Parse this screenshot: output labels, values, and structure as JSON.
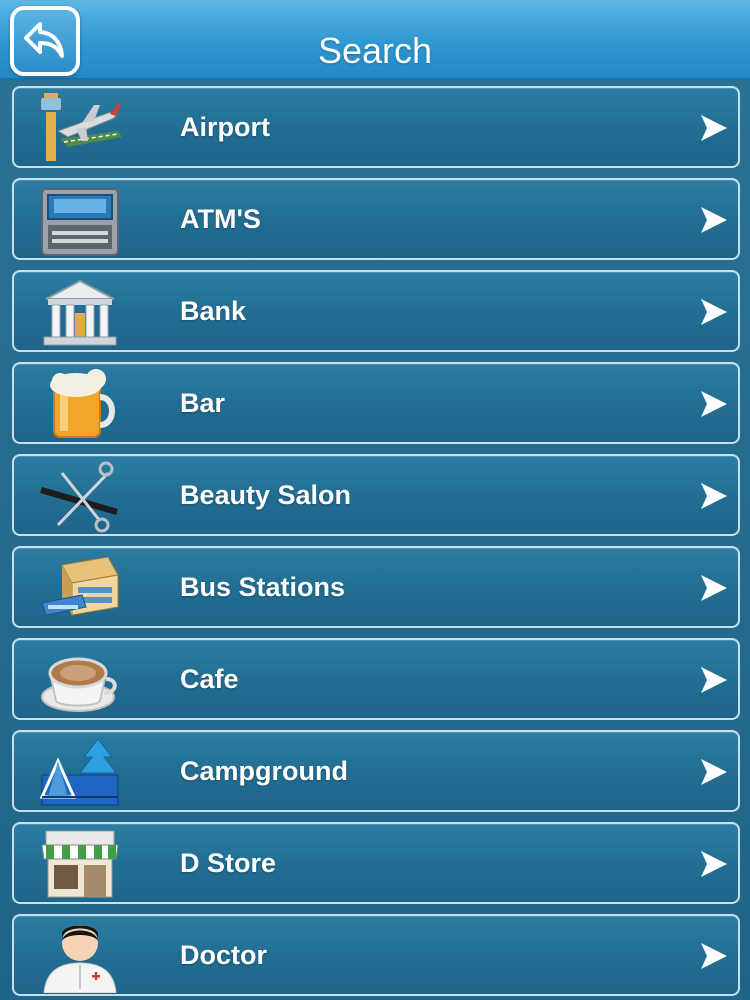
{
  "header": {
    "title": "Search"
  },
  "items": [
    {
      "label": "Airport",
      "icon": "airport-icon"
    },
    {
      "label": "ATM'S",
      "icon": "atm-icon"
    },
    {
      "label": "Bank",
      "icon": "bank-icon"
    },
    {
      "label": "Bar",
      "icon": "beer-icon"
    },
    {
      "label": "Beauty Salon",
      "icon": "scissors-comb-icon"
    },
    {
      "label": "Bus Stations",
      "icon": "bus-station-icon"
    },
    {
      "label": "Cafe",
      "icon": "coffee-cup-icon"
    },
    {
      "label": "Campground",
      "icon": "campground-icon"
    },
    {
      "label": "D Store",
      "icon": "store-icon"
    },
    {
      "label": "Doctor",
      "icon": "doctor-icon"
    }
  ],
  "colors": {
    "header": "#2f97d2",
    "background": "#226d92",
    "row_border": "#c9dfe9",
    "text": "#ffffff"
  }
}
